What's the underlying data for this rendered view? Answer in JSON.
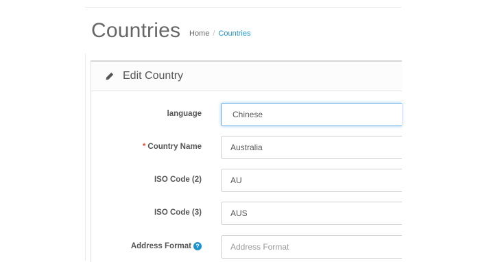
{
  "header": {
    "title": "Countries",
    "breadcrumb": {
      "home": "Home",
      "separator": "/",
      "current": "Countries"
    }
  },
  "panel": {
    "title": "Edit Country",
    "icon": "pencil-icon"
  },
  "form": {
    "language": {
      "label": "language",
      "value": "Chinese"
    },
    "country_name": {
      "label": "Country Name",
      "required_mark": "*",
      "value": "Australia"
    },
    "iso_code_2": {
      "label": "ISO Code (2)",
      "value": "AU"
    },
    "iso_code_3": {
      "label": "ISO Code (3)",
      "value": "AUS"
    },
    "address_format": {
      "label": "Address Format",
      "help_icon": "?",
      "value": "",
      "placeholder": "Address Format"
    }
  },
  "colors": {
    "accent": "#1e91cf",
    "required": "#e3503e",
    "focus": "#66afe9"
  }
}
